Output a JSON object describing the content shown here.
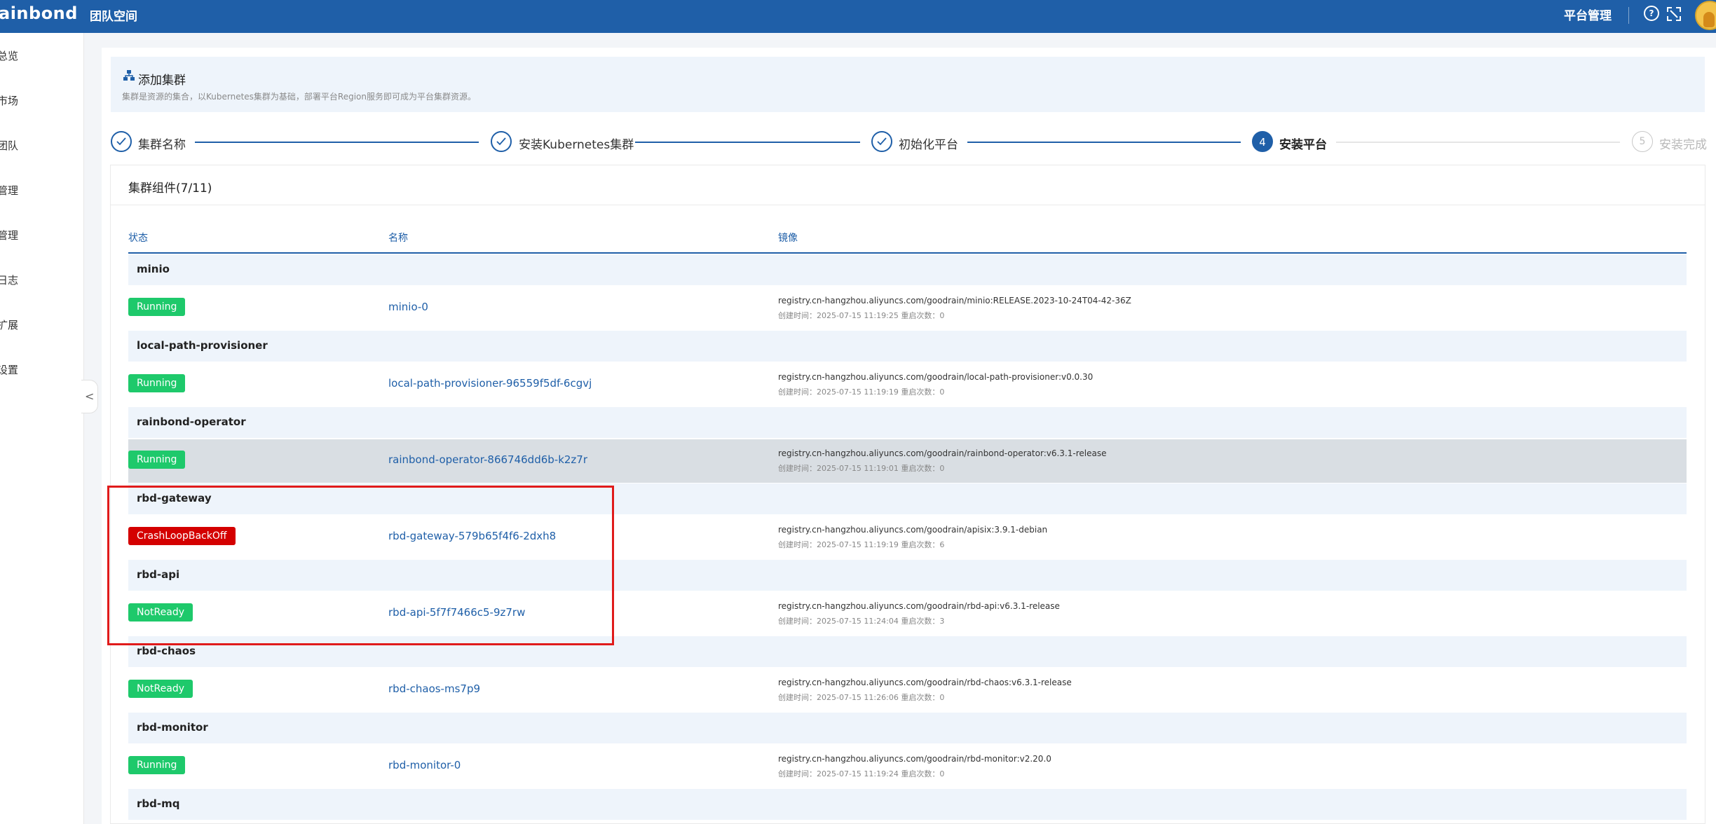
{
  "topbar": {
    "logo": "ainbond",
    "team_title": "团队空间",
    "platform_management": "平台管理",
    "help_glyph": "?",
    "icons": [
      "help-icon",
      "fullscreen-exit-icon",
      "avatar"
    ]
  },
  "sidebar": {
    "items": [
      "总览",
      "市场",
      "团队",
      "管理",
      "管理",
      "日志",
      "扩展",
      "设置"
    ],
    "collapse_glyph": "<"
  },
  "header": {
    "title": "添加集群",
    "description": "集群是资源的集合，以Kubernetes集群为基础，部署平台Region服务即可成为平台集群资源。"
  },
  "steps": [
    {
      "label": "集群名称",
      "status": "done"
    },
    {
      "label": "安装Kubernetes集群",
      "status": "done"
    },
    {
      "label": "初始化平台",
      "status": "done"
    },
    {
      "label": "安装平台",
      "status": "active",
      "number": "4"
    },
    {
      "label": "安装完成",
      "status": "pending",
      "number": "5"
    }
  ],
  "components": {
    "title": "集群组件(7/11)",
    "columns": {
      "status": "状态",
      "name": "名称",
      "image": "镜像"
    },
    "groups": [
      {
        "name": "minio",
        "pod": {
          "status": "Running",
          "pod_name": "minio-0",
          "image": "registry.cn-hangzhou.aliyuncs.com/goodrain/minio:RELEASE.2023-10-24T04-42-36Z",
          "meta": "创建时间：2025-07-15 11:19:25 重启次数：0"
        }
      },
      {
        "name": "local-path-provisioner",
        "pod": {
          "status": "Running",
          "pod_name": "local-path-provisioner-96559f5df-6cgvj",
          "image": "registry.cn-hangzhou.aliyuncs.com/goodrain/local-path-provisioner:v0.0.30",
          "meta": "创建时间：2025-07-15 11:19:19 重启次数：0"
        }
      },
      {
        "name": "rainbond-operator",
        "pod": {
          "status": "Running",
          "pod_name": "rainbond-operator-866746dd6b-k2z7r",
          "image": "registry.cn-hangzhou.aliyuncs.com/goodrain/rainbond-operator:v6.3.1-release",
          "meta": "创建时间：2025-07-15 11:19:01 重启次数：0"
        }
      },
      {
        "name": "rbd-gateway",
        "pod": {
          "status": "CrashLoopBackOff",
          "pod_name": "rbd-gateway-579b65f4f6-2dxh8",
          "image": "registry.cn-hangzhou.aliyuncs.com/goodrain/apisix:3.9.1-debian",
          "meta": "创建时间：2025-07-15 11:19:19 重启次数：6"
        }
      },
      {
        "name": "rbd-api",
        "pod": {
          "status": "NotReady",
          "pod_name": "rbd-api-5f7f7466c5-9z7rw",
          "image": "registry.cn-hangzhou.aliyuncs.com/goodrain/rbd-api:v6.3.1-release",
          "meta": "创建时间：2025-07-15 11:24:04 重启次数：3"
        }
      },
      {
        "name": "rbd-chaos",
        "pod": {
          "status": "NotReady",
          "pod_name": "rbd-chaos-ms7p9",
          "image": "registry.cn-hangzhou.aliyuncs.com/goodrain/rbd-chaos:v6.3.1-release",
          "meta": "创建时间：2025-07-15 11:26:06 重启次数：0"
        }
      },
      {
        "name": "rbd-monitor",
        "pod": {
          "status": "Running",
          "pod_name": "rbd-monitor-0",
          "image": "registry.cn-hangzhou.aliyuncs.com/goodrain/rbd-monitor:v2.20.0",
          "meta": "创建时间：2025-07-15 11:19:24 重启次数：0"
        }
      },
      {
        "name": "rbd-mq"
      }
    ]
  },
  "colors": {
    "primary": "#1f5fa8",
    "running": "#1ec96b",
    "error": "#d40000",
    "highlight_box": "#e01b1b"
  }
}
